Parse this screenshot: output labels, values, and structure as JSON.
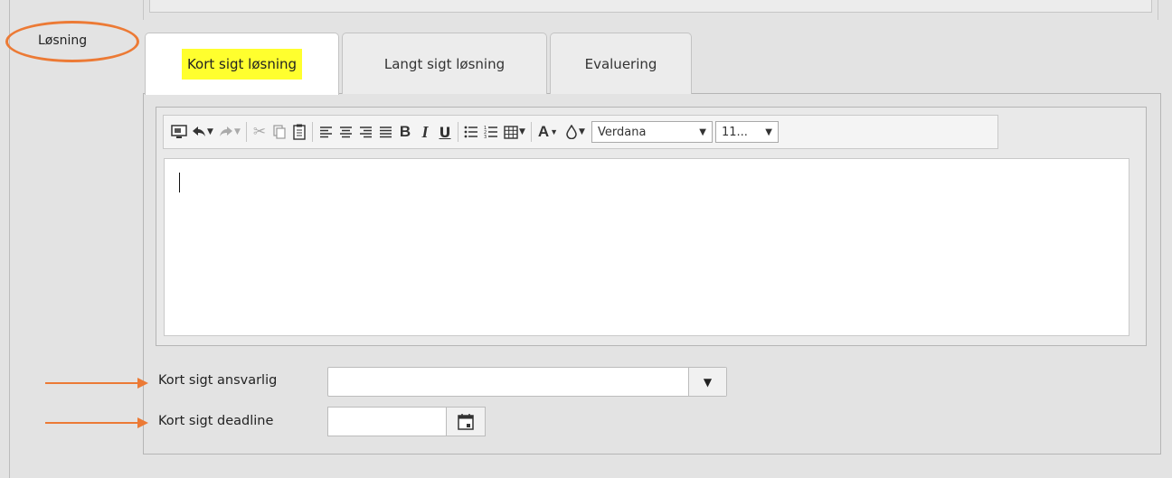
{
  "section": {
    "label": "Løsning"
  },
  "tabs": [
    {
      "label": "Kort sigt løsning",
      "active": true
    },
    {
      "label": "Langt sigt løsning",
      "active": false
    },
    {
      "label": "Evaluering",
      "active": false
    }
  ],
  "toolbar": {
    "font_family": "Verdana",
    "font_size": "11..."
  },
  "fields": {
    "responsible": {
      "label": "Kort sigt ansvarlig",
      "value": ""
    },
    "deadline": {
      "label": "Kort sigt deadline",
      "value": ""
    }
  },
  "colors": {
    "annotation": "#ec7a35",
    "tab_highlight": "#ffff2e"
  }
}
